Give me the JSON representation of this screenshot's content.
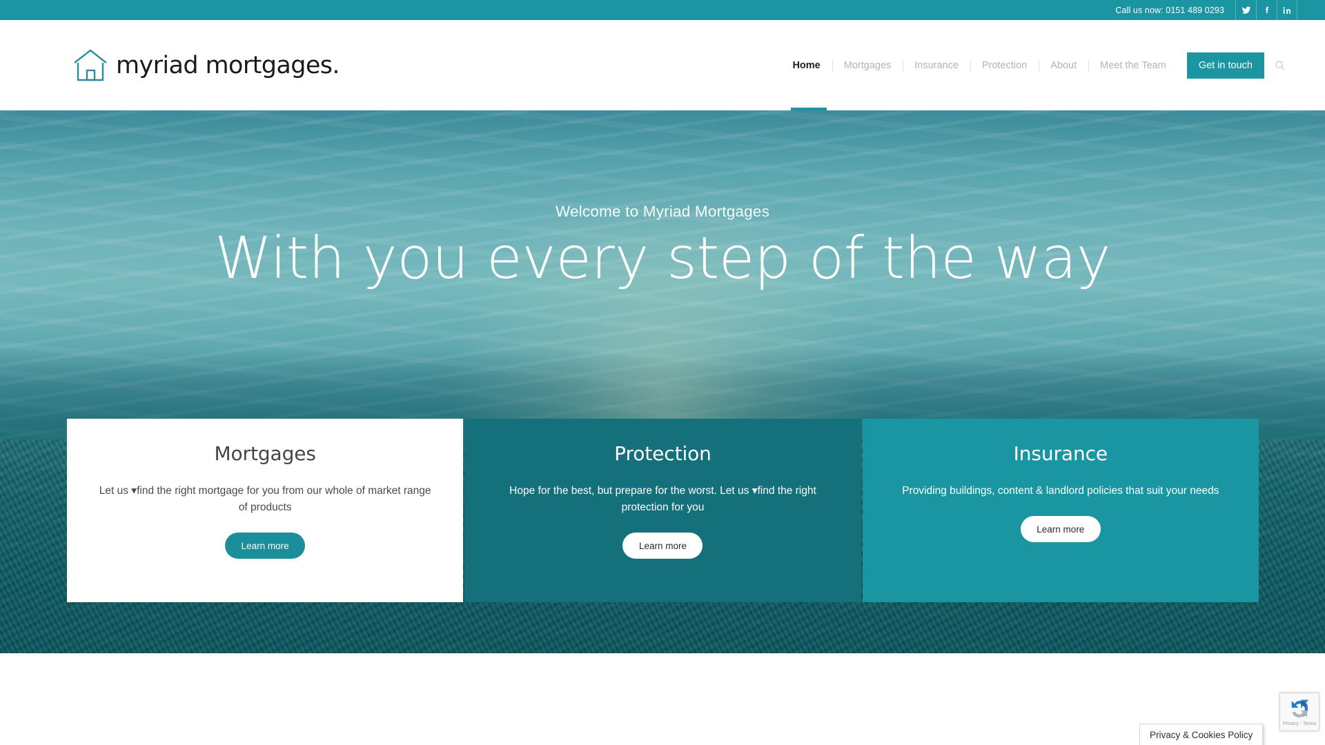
{
  "topbar": {
    "phone_label": "Call us now: 0151 489 0293",
    "social": [
      {
        "name": "twitter-icon",
        "label": "Twitter"
      },
      {
        "name": "facebook-icon",
        "label": "Facebook"
      },
      {
        "name": "linkedin-icon",
        "label": "LinkedIn"
      }
    ],
    "background_color": "#1b95a2"
  },
  "header": {
    "logo_text": "myriad mortgages.",
    "logo_icon": "house-outline-icon",
    "logo_icon_color": "#2a8f9b",
    "nav": [
      {
        "label": "Home",
        "active": true
      },
      {
        "label": "Mortgages",
        "active": false
      },
      {
        "label": "Insurance",
        "active": false
      },
      {
        "label": "Protection",
        "active": false
      },
      {
        "label": "About",
        "active": false
      },
      {
        "label": "Meet the Team",
        "active": false
      }
    ],
    "cta_label": "Get in touch",
    "search_icon": "search-icon",
    "accent_color": "#1b95a2"
  },
  "hero": {
    "eyebrow": "Welcome to Myriad Mortgages",
    "title": "With you every step of the way",
    "background": "teal-tinted aerial photo of sky, clouds and city rooftops"
  },
  "cards": [
    {
      "title": "Mortgages",
      "text": "Let us ▾find the right mortgage for you from our whole of market range of products",
      "button_label": "Learn more",
      "style": "light",
      "background_color": "#ffffff",
      "button_color": "#1a8f9b"
    },
    {
      "title": "Protection",
      "text": "Hope for the best, but prepare for the worst. Let us ▾find the right protection for you",
      "button_label": "Learn more",
      "style": "dark",
      "background_color": "#14707a",
      "button_color": "#ffffff"
    },
    {
      "title": "Insurance",
      "text": "Providing buildings, content & landlord policies that suit your needs",
      "button_label": "Learn more",
      "style": "mid",
      "background_color": "#1a96a3",
      "button_color": "#ffffff"
    }
  ],
  "recaptcha": {
    "label": "Privacy - Terms",
    "icon": "recaptcha-logo-icon"
  },
  "cookie_tooltip": {
    "label": "Privacy & Cookies Policy"
  }
}
